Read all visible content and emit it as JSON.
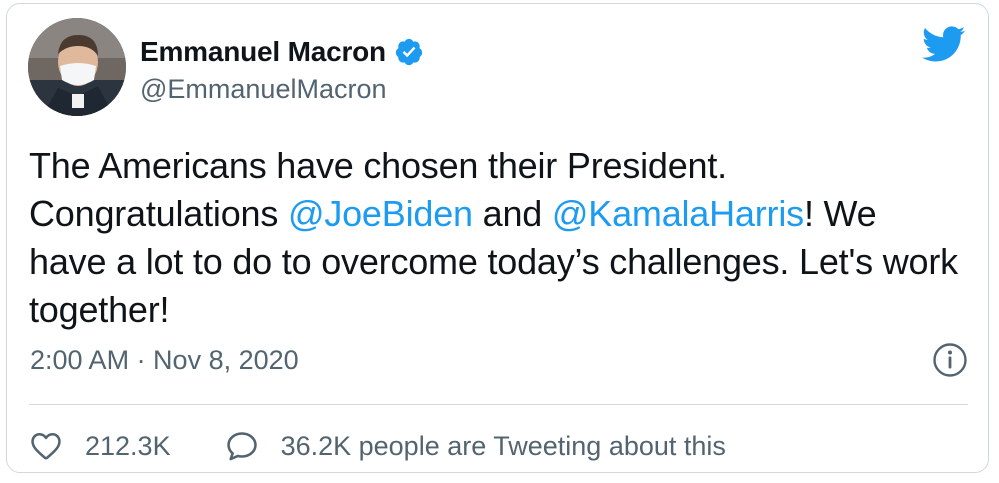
{
  "author": {
    "display_name": "Emmanuel Macron",
    "handle": "@EmmanuelMacron",
    "verified": true,
    "avatar_icon": "profile-photo-icon"
  },
  "brand": {
    "icon": "twitter-bird-icon",
    "color": "#1d9bf0"
  },
  "tweet": {
    "text_parts": [
      {
        "type": "text",
        "value": "The Americans have chosen their President. Congratulations "
      },
      {
        "type": "mention",
        "value": "@JoeBiden"
      },
      {
        "type": "text",
        "value": " and "
      },
      {
        "type": "mention",
        "value": "@KamalaHarris"
      },
      {
        "type": "text",
        "value": "! We have a lot to do to overcome today’s challenges. Let's work together!"
      }
    ]
  },
  "meta": {
    "timestamp": "2:00 AM · Nov 8, 2020",
    "info_icon": "info-icon"
  },
  "actions": {
    "likes": "212.3K",
    "tweeting": "36.2K people are Tweeting about this"
  }
}
